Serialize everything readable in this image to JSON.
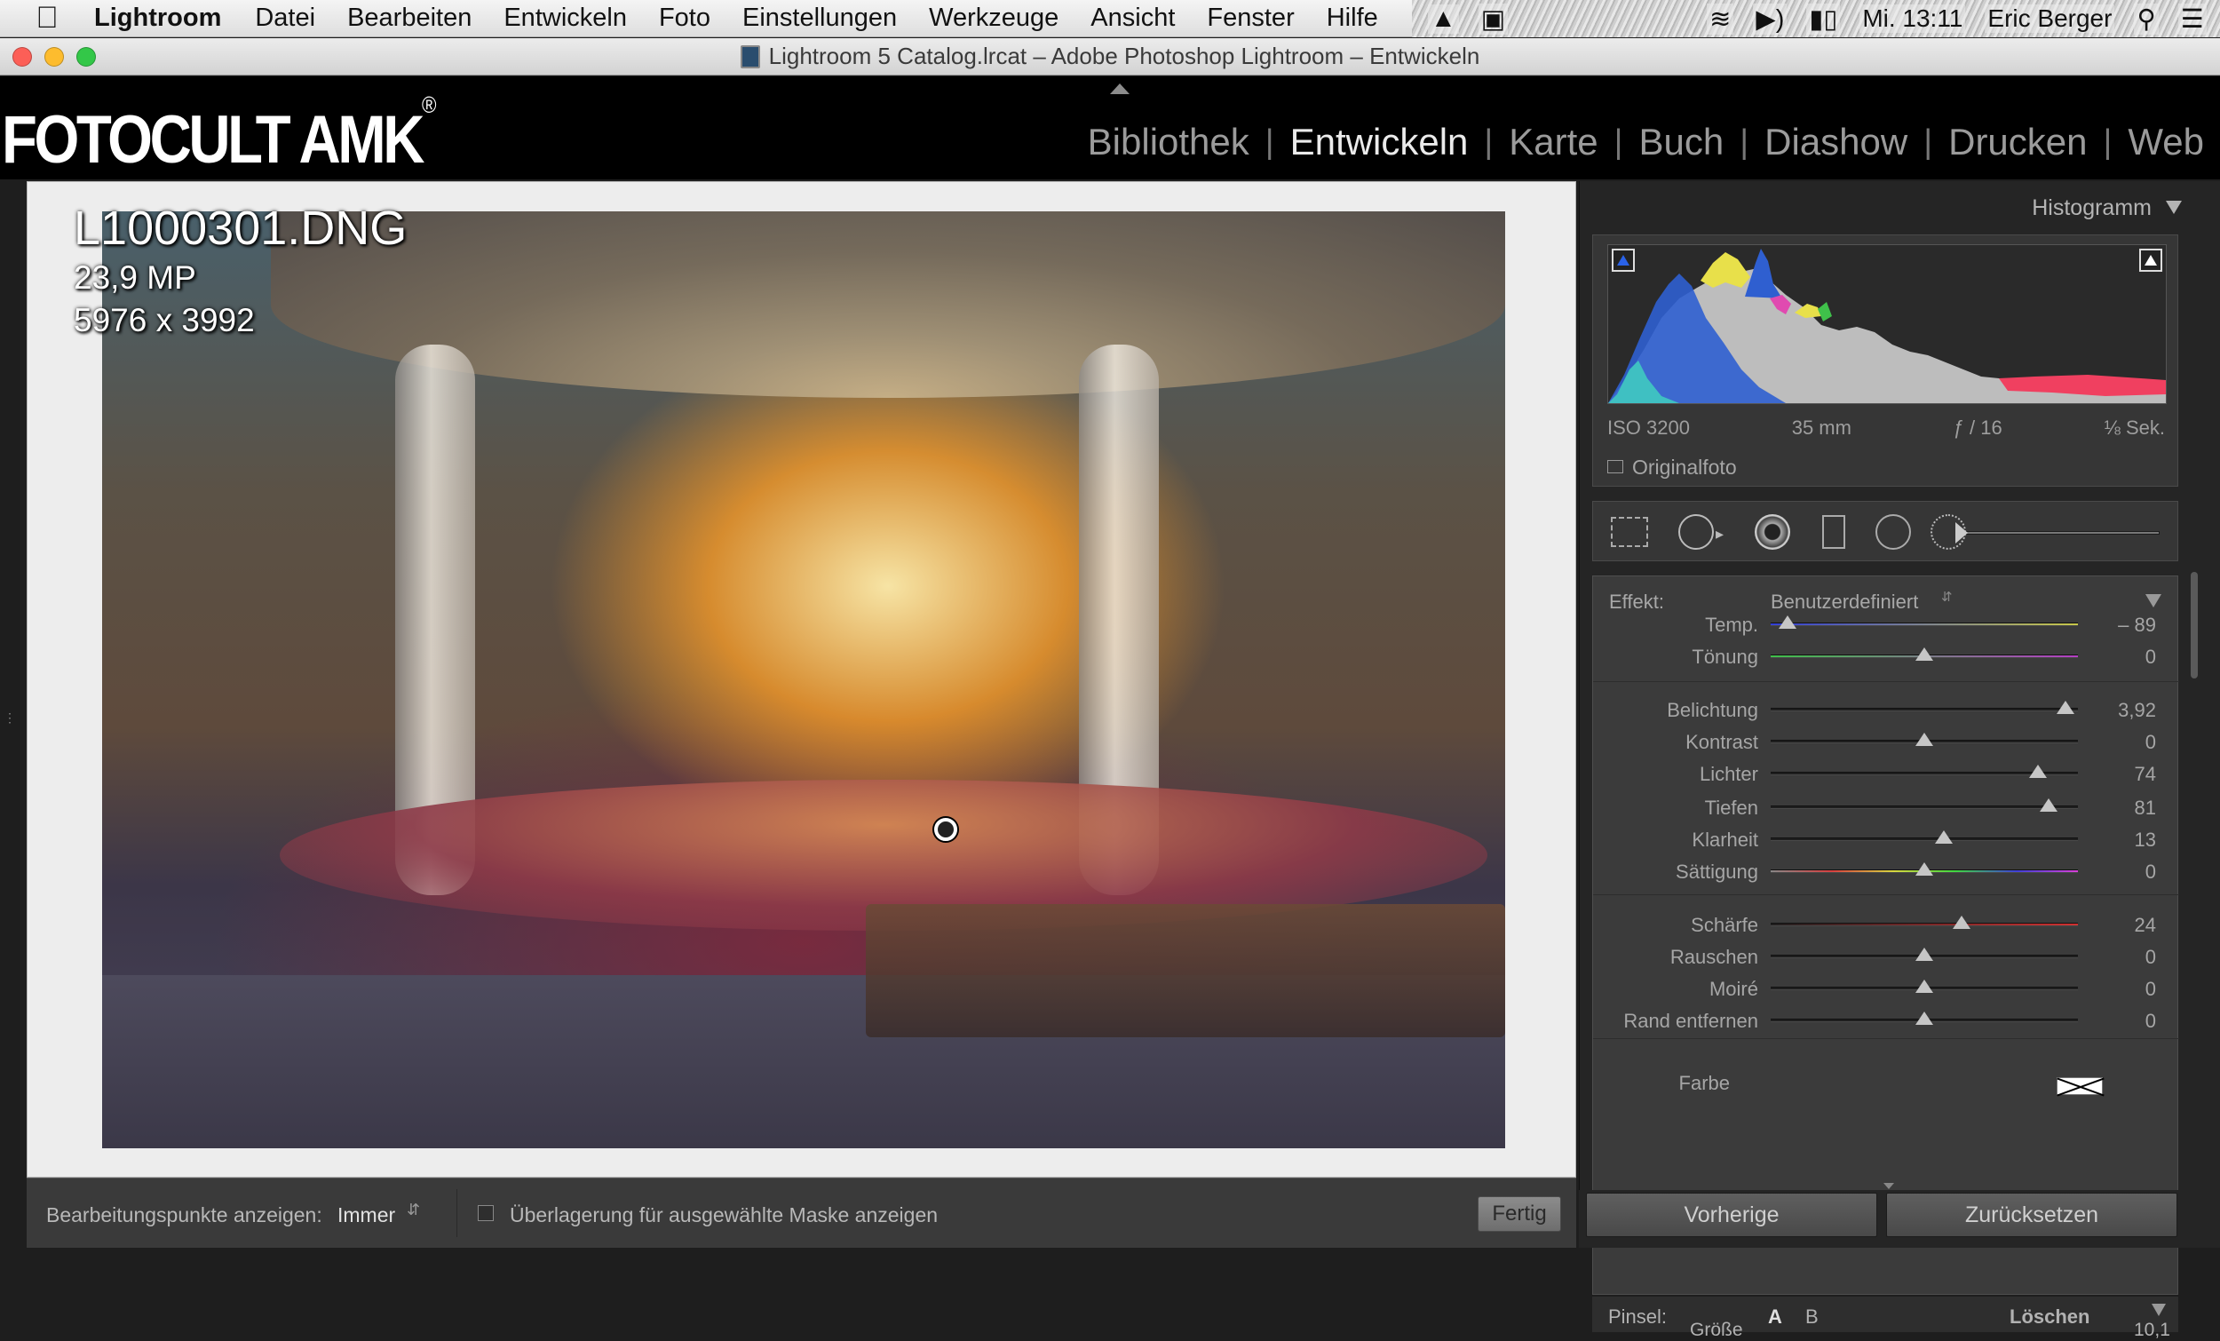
{
  "menubar": {
    "app": "Lightroom",
    "menus": [
      "Datei",
      "Bearbeiten",
      "Entwickeln",
      "Foto",
      "Einstellungen",
      "Werkzeuge",
      "Ansicht",
      "Fenster",
      "Hilfe"
    ],
    "clock": "Mi. 13:11",
    "user": "Eric Berger",
    "icons": [
      "apple-icon",
      "upload-icon",
      "screen-icon",
      "wifi-icon",
      "volume-icon",
      "battery-icon",
      "search-icon",
      "list-icon"
    ]
  },
  "window": {
    "title": "Lightroom 5 Catalog.lrcat – Adobe Photoshop Lightroom – Entwickeln"
  },
  "identity_plate": {
    "text": "FOTOCULT AMK",
    "registered": "®"
  },
  "modules": [
    "Bibliothek",
    "Entwickeln",
    "Karte",
    "Buch",
    "Diashow",
    "Drucken",
    "Web"
  ],
  "active_module": "Entwickeln",
  "photo_info": {
    "filename": "L1000301.DNG",
    "megapixels": "23,9 MP",
    "dimensions": "5976 x 3992"
  },
  "toolbar": {
    "show_pins_label": "Bearbeitungspunkte anzeigen:",
    "show_pins_value": "Immer",
    "overlay_label": "Überlagerung für ausgewählte Maske anzeigen",
    "done_button": "Fertig"
  },
  "histogram": {
    "title": "Histogramm",
    "exif": {
      "iso": "ISO 3200",
      "focal": "35 mm",
      "aperture": "ƒ / 16",
      "shutter": "⅛ Sek."
    },
    "original_label": "Originalfoto"
  },
  "adjustment_brush": {
    "effect_label": "Effekt:",
    "effect_value": "Benutzerdefiniert",
    "sliders": [
      {
        "label": "Temp.",
        "value": "– 89",
        "pos": -0.89,
        "track": "temp"
      },
      {
        "label": "Tönung",
        "value": "0",
        "pos": 0,
        "track": "tint"
      },
      {
        "label": "Belichtung",
        "value": "3,92",
        "pos": 0.92,
        "track": "plain"
      },
      {
        "label": "Kontrast",
        "value": "0",
        "pos": 0,
        "track": "plain"
      },
      {
        "label": "Lichter",
        "value": "74",
        "pos": 0.74,
        "track": "plain"
      },
      {
        "label": "Tiefen",
        "value": "81",
        "pos": 0.81,
        "track": "plain"
      },
      {
        "label": "Klarheit",
        "value": "13",
        "pos": 0.13,
        "track": "plain"
      },
      {
        "label": "Sättigung",
        "value": "0",
        "pos": 0,
        "track": "sat"
      },
      {
        "label": "Schärfe",
        "value": "24",
        "pos": 0.24,
        "track": "sharp"
      },
      {
        "label": "Rauschen",
        "value": "0",
        "pos": 0,
        "track": "plain"
      },
      {
        "label": "Moiré",
        "value": "0",
        "pos": 0,
        "track": "plain"
      },
      {
        "label": "Rand entfernen",
        "value": "0",
        "pos": 0,
        "track": "plain"
      }
    ],
    "color_label": "Farbe",
    "brush_label": "Pinsel:",
    "brush_a": "A",
    "brush_b": "B",
    "brush_erase": "Löschen",
    "size_label": "Größe",
    "size_value": "10,1"
  },
  "panel_buttons": {
    "previous": "Vorherige",
    "reset": "Zurücksetzen"
  },
  "colors": {
    "accent_blue": "#2a62e8",
    "temp_track": [
      "#3340d6",
      "#c8c84a"
    ],
    "tint_track": [
      "#3fc04a",
      "#b53fc4"
    ],
    "sat_track": [
      "#888888",
      "#d84040",
      "#d8d840",
      "#40d840",
      "#4040d8",
      "#d840d8"
    ],
    "sharp_track": [
      "#1f1f1f",
      "#d03030"
    ]
  }
}
